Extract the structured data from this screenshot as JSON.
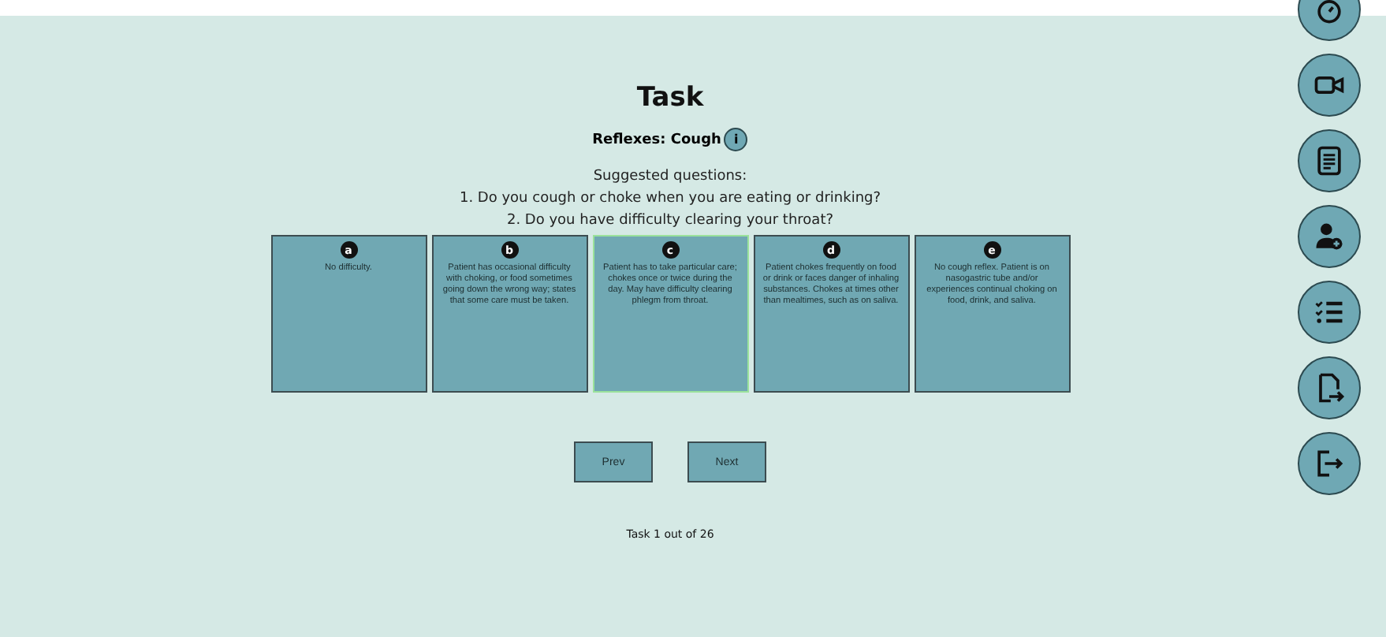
{
  "title": "Task",
  "subtitle": {
    "label": "Reflexes: Cough",
    "info_icon": "i"
  },
  "questions": {
    "heading": "Suggested questions:",
    "items": [
      "1. Do you cough or choke when you are eating or drinking?",
      "2. Do you have difficulty clearing your throat?"
    ]
  },
  "options": [
    {
      "letter": "a",
      "text": "No difficulty.",
      "selected": false
    },
    {
      "letter": "b",
      "text": "Patient has occasional difficulty with choking, or food sometimes going down the wrong way; states that some care must be taken.",
      "selected": false
    },
    {
      "letter": "c",
      "text": "Patient has to take particular care; chokes once or twice during the day. May have difficulty clearing phlegm from throat.",
      "selected": true
    },
    {
      "letter": "d",
      "text": "Patient chokes frequently on food or drink or faces danger of inhaling substances. Chokes at times other than mealtimes, such as on saliva.",
      "selected": false
    },
    {
      "letter": "e",
      "text": "No cough reflex. Patient is on nasogastric tube and/or experiences continual choking on food, drink, and saliva.",
      "selected": false
    }
  ],
  "buttons": [
    "Prev",
    "Next"
  ],
  "progress": "Task 1 out of 26",
  "sidebar": [
    {
      "kind": "timer"
    },
    {
      "kind": "video"
    },
    {
      "kind": "notes"
    },
    {
      "kind": "add-person"
    },
    {
      "kind": "checklist"
    },
    {
      "kind": "export"
    },
    {
      "kind": "exit"
    }
  ]
}
